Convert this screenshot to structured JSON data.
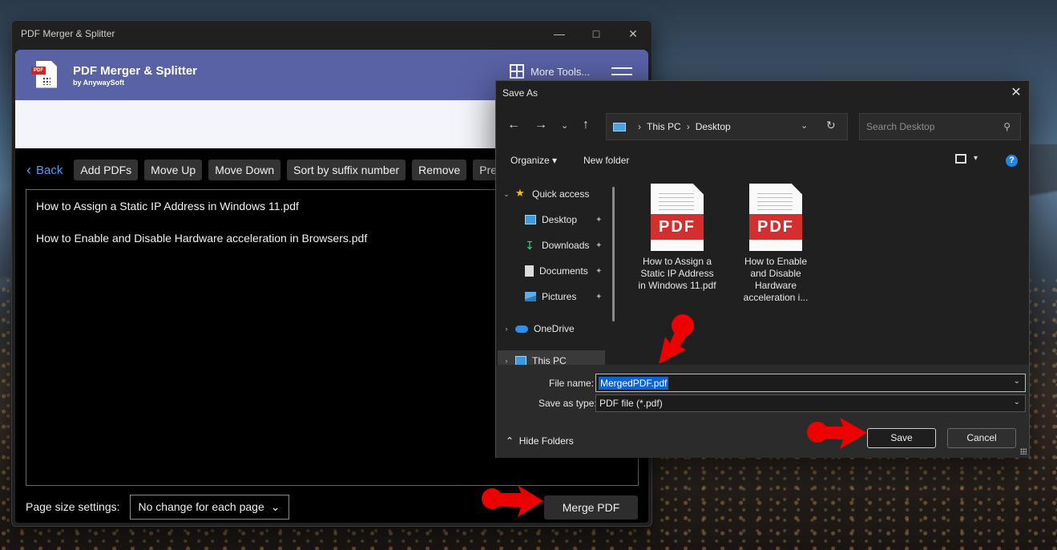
{
  "app": {
    "window_title": "PDF Merger & Splitter",
    "brand_title": "PDF Merger & Splitter",
    "brand_subtitle": "by AnywaySoft",
    "more_tools_label": "More Tools...",
    "toolbar": {
      "back_label": "Back",
      "buttons": [
        "Add PDFs",
        "Move Up",
        "Move Down",
        "Sort by suffix number",
        "Remove",
        "Pre"
      ]
    },
    "files": [
      "How to Assign a Static IP Address in Windows 11.pdf",
      "How to Enable and Disable Hardware acceleration in Browsers.pdf"
    ],
    "page_size_label": "Page size settings:",
    "page_size_value": "No change for each page",
    "merge_label": "Merge PDF"
  },
  "dialog": {
    "title": "Save As",
    "path": [
      "This PC",
      "Desktop"
    ],
    "search_placeholder": "Search Desktop",
    "organize_label": "Organize",
    "new_folder_label": "New folder",
    "nav": {
      "quick_access": "Quick access",
      "items": [
        "Desktop",
        "Downloads",
        "Documents",
        "Pictures"
      ],
      "onedrive": "OneDrive",
      "this_pc": "This PC"
    },
    "files": [
      {
        "badge": "PDF",
        "name": "How to Assign a Static IP Address in Windows 11.pdf"
      },
      {
        "badge": "PDF",
        "name": "How to Enable and Disable Hardware acceleration i..."
      }
    ],
    "file_name_label": "File name:",
    "file_name_value": "MergedPDF.pdf",
    "save_type_label": "Save as type:",
    "save_type_value": "PDF file (*.pdf)",
    "hide_folders_label": "Hide Folders",
    "save_label": "Save",
    "cancel_label": "Cancel"
  },
  "colors": {
    "header": "#5a62a6",
    "accent_link": "#4d9bff",
    "pdf_badge": "#d32f2f",
    "annotation_arrow": "#ee0000",
    "selection": "#0a64d8"
  }
}
